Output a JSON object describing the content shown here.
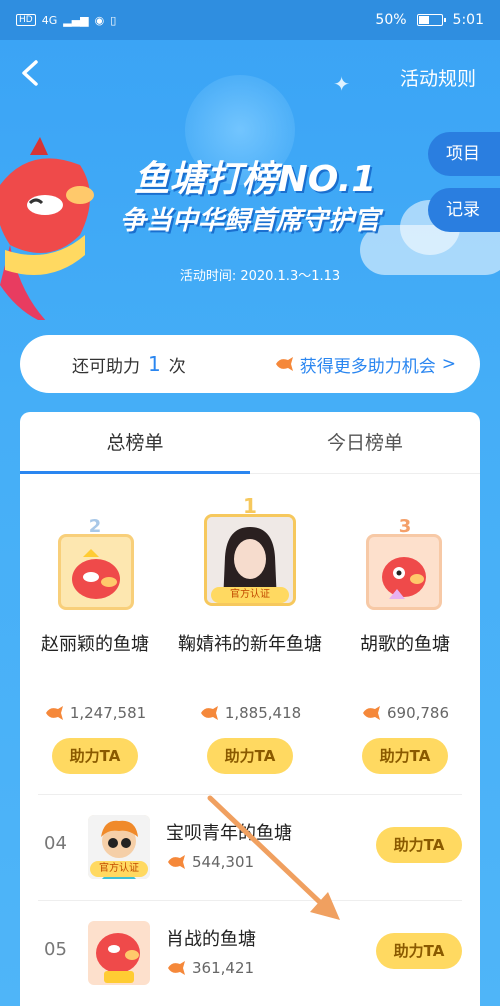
{
  "status_bar": {
    "hd": "HD",
    "network": "4G",
    "battery_text": "50%",
    "time": "5:01"
  },
  "header": {
    "back_icon": "chevron-left-icon",
    "rules_label": "活动规则",
    "title": "鱼塘打榜NO.1",
    "subtitle": "争当中华鲟首席守护官",
    "activity_time": "活动时间: 2020.1.3～1.13",
    "side_tabs": [
      {
        "label": "项目"
      },
      {
        "label": "记录"
      }
    ]
  },
  "help_bar": {
    "prefix": "还可助力",
    "count": "1",
    "suffix": "次",
    "more_label": "获得更多助力机会",
    "more_chevron": ">"
  },
  "board": {
    "tabs": [
      {
        "label": "总榜单",
        "active": true
      },
      {
        "label": "今日榜单",
        "active": false
      }
    ],
    "podium": [
      {
        "rank": "2",
        "name": "赵丽颖的鱼塘",
        "score": "1,247,581",
        "button": "助力TA"
      },
      {
        "rank": "1",
        "name": "鞠婧祎的新年鱼塘",
        "score": "1,885,418",
        "button": "助力TA",
        "official": "官方认证"
      },
      {
        "rank": "3",
        "name": "胡歌的鱼塘",
        "score": "690,786",
        "button": "助力TA"
      }
    ],
    "rows": [
      {
        "rank": "04",
        "name": "宝呗青年的鱼塘",
        "score": "544,301",
        "button": "助力TA",
        "official": "官方认证"
      },
      {
        "rank": "05",
        "name": "肖战的鱼塘",
        "score": "361,421",
        "button": "助力TA"
      }
    ]
  },
  "colors": {
    "accent": "#2a86f0",
    "button_yellow": "#ffd961",
    "background": "#45aef7",
    "arrow": "#f0a060"
  }
}
